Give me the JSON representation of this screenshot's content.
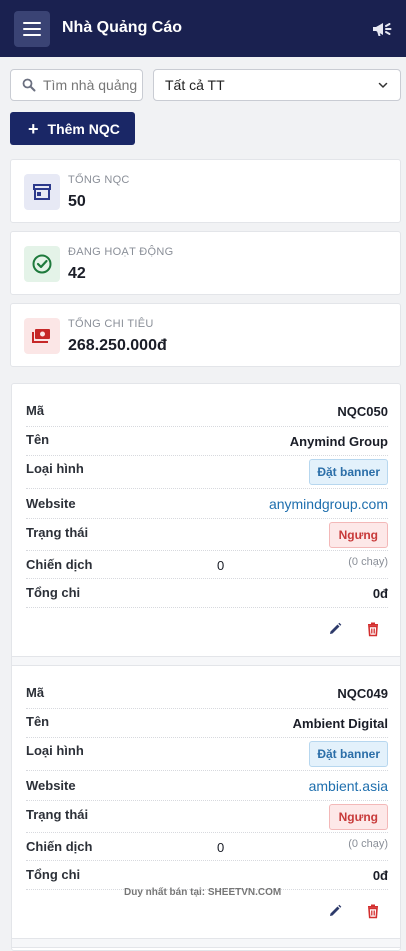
{
  "header": {
    "title": "Nhà Quảng Cáo",
    "menu_icon": "hamburger-menu-icon",
    "action_icon": "megaphone-icon"
  },
  "filters": {
    "search_placeholder": "Tìm nhà quảng cáo",
    "status_selected": "Tất cả TT"
  },
  "add_button": {
    "label": "Thêm NQC"
  },
  "stats": [
    {
      "label": "Tổng NQC",
      "value": "50",
      "icon": "storefront-icon",
      "color": "#2d3a8c"
    },
    {
      "label": "Đang hoạt động",
      "value": "42",
      "icon": "check-circle-icon",
      "color": "#1e7a3c"
    },
    {
      "label": "Tổng chi tiêu",
      "value": "268.250.000đ",
      "icon": "money-icon",
      "color": "#c62828"
    }
  ],
  "field_labels": {
    "code": "Mã",
    "name": "Tên",
    "type": "Loại hình",
    "website": "Website",
    "status": "Trạng thái",
    "campaigns": "Chiến dịch",
    "total_spend": "Tổng chi"
  },
  "advertisers": [
    {
      "code": "NQC050",
      "name": "Anymind Group",
      "type": "Đặt banner",
      "website": "anymindgroup.com",
      "status": "Ngưng",
      "campaigns": "0",
      "running": "(0 chạy)",
      "total_spend": "0đ"
    },
    {
      "code": "NQC049",
      "name": "Ambient Digital",
      "type": "Đặt banner",
      "website": "ambient.asia",
      "status": "Ngưng",
      "campaigns": "0",
      "running": "(0 chạy)",
      "total_spend": "0đ"
    }
  ],
  "watermark": "Duy nhất bán tại: SHEETVN.COM",
  "colors": {
    "header_bg": "#1a2150",
    "primary": "#1a2766",
    "badge_blue": "#2b6ea8",
    "badge_red": "#c83a3a",
    "edit_icon": "#2d3a6a",
    "delete_icon": "#d32f2f"
  }
}
